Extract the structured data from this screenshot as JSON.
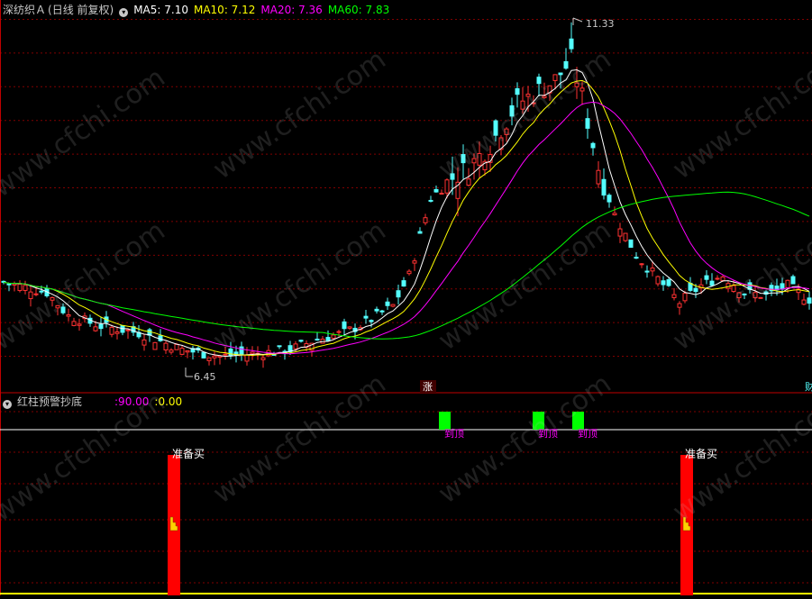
{
  "main_panel": {
    "stock_name": "深纺织Ａ",
    "period_label": "(日线 前复权)",
    "ma": [
      {
        "label": "MA5:",
        "value": "7.10",
        "color": "#ffffff"
      },
      {
        "label": "MA10:",
        "value": "7.12",
        "color": "#ffff00"
      },
      {
        "label": "MA20:",
        "value": "7.36",
        "color": "#ff00ff"
      },
      {
        "label": "MA60:",
        "value": "7.83",
        "color": "#00ff00"
      }
    ],
    "high_label": "11.33",
    "low_label": "6.45",
    "zhang_marker": "涨",
    "right_edge_marker": "财"
  },
  "sub_panel": {
    "indicator_name": "红柱预警抄底",
    "values": [
      {
        "value": ":90.00",
        "color": "#ff00ff"
      },
      {
        "value": ":0.00",
        "color": "#ffff00"
      }
    ],
    "signal_label": "到顶",
    "buy_label": "准备买"
  },
  "watermark_text": "www.cfchi.com",
  "colors": {
    "up": "#ff3232",
    "down": "#54ffff",
    "grid": "#800000",
    "ma5": "#ffffff",
    "ma10": "#ffff00",
    "ma20": "#ff00ff",
    "ma60": "#00ff00",
    "signal_green": "#00ff00",
    "buy_red": "#ff0000"
  },
  "chart_data": {
    "type": "candlestick",
    "price_ylim": [
      6.2,
      11.6
    ],
    "high": 11.33,
    "low": 6.45,
    "signals": {
      "top_count": 3,
      "buy_count": 2
    }
  }
}
